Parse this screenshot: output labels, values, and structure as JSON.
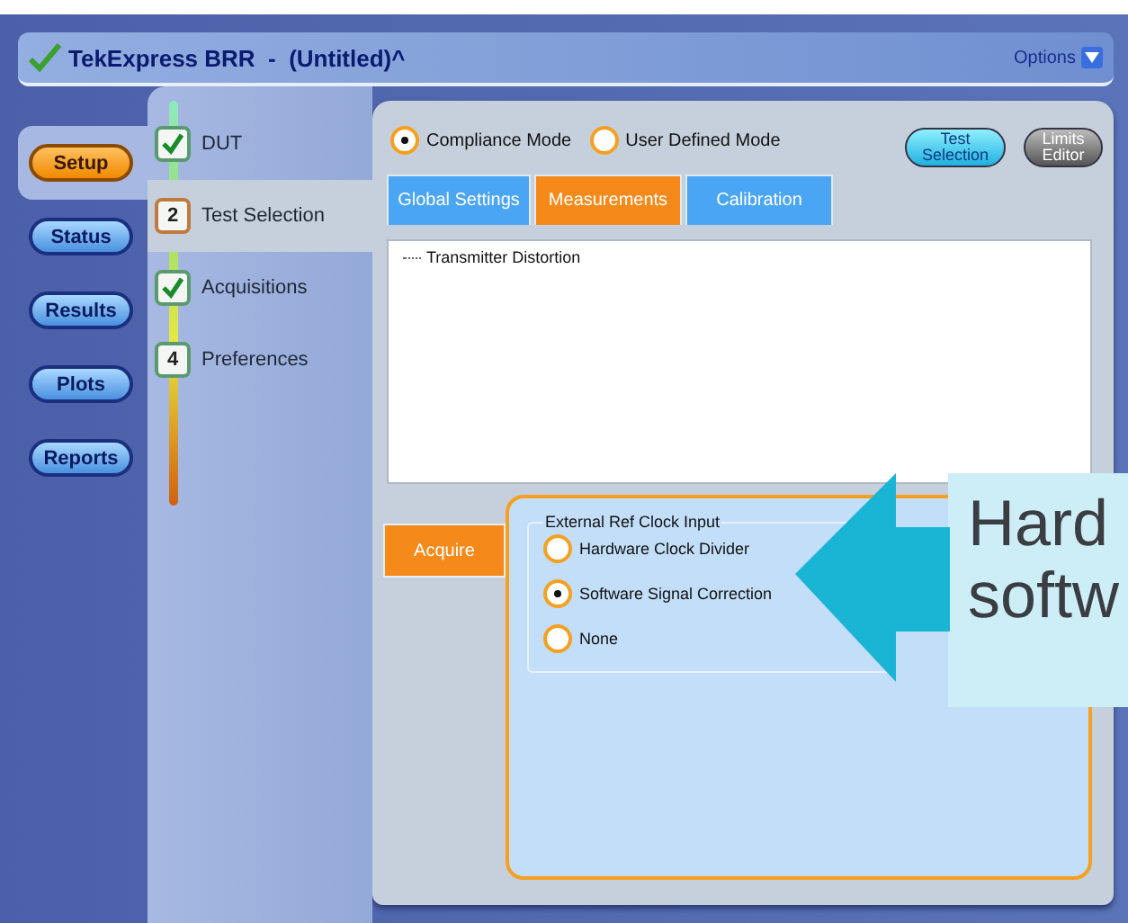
{
  "window": {
    "title": "TekExpress BRR  -  (Untitled)^",
    "options": "Options"
  },
  "nav": [
    {
      "label": "Setup",
      "selected": true
    },
    {
      "label": "Status",
      "selected": false
    },
    {
      "label": "Results",
      "selected": false
    },
    {
      "label": "Plots",
      "selected": false
    },
    {
      "label": "Reports",
      "selected": false
    }
  ],
  "steps": [
    {
      "label": "DUT",
      "done": true,
      "selected": false
    },
    {
      "marker": "2",
      "label": "Test Selection",
      "done": false,
      "selected": true
    },
    {
      "label": "Acquisitions",
      "done": true,
      "selected": false
    },
    {
      "marker": "4",
      "label": "Preferences",
      "done": false,
      "selected": false
    }
  ],
  "modes": [
    {
      "label": "Compliance Mode",
      "selected": true
    },
    {
      "label": "User Defined Mode",
      "selected": false
    }
  ],
  "actions": [
    {
      "label": "Test Selection",
      "kind": "cyan"
    },
    {
      "label": "Limits Editor",
      "kind": "grey"
    }
  ],
  "tabs": [
    {
      "label": "Global Settings",
      "selected": false
    },
    {
      "label": "Measurements",
      "selected": true
    },
    {
      "label": "Calibration",
      "selected": false
    }
  ],
  "tree": [
    {
      "label": "Transmitter Distortion"
    }
  ],
  "side_tab": {
    "label": "Acquire",
    "selected": true
  },
  "clock_group": {
    "legend": "External Ref Clock Input",
    "options": [
      {
        "label": "Hardware Clock Divider",
        "selected": false
      },
      {
        "label": "Software Signal Correction",
        "selected": true
      },
      {
        "label": "None",
        "selected": false
      }
    ]
  },
  "callout": {
    "lines": [
      "Hard",
      "softw"
    ]
  }
}
